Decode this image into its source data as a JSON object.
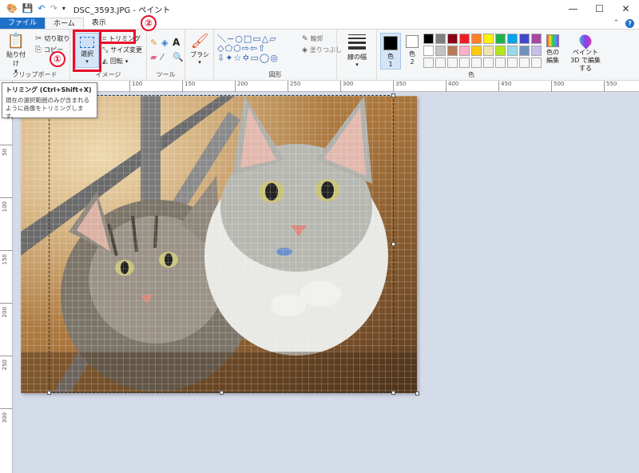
{
  "window": {
    "title": "DSC_3593.JPG - ペイント",
    "controls": {
      "minimize": "—",
      "maximize": "☐",
      "close": "✕"
    }
  },
  "tabs": {
    "file": "ファイル",
    "home": "ホーム",
    "view": "表示"
  },
  "ribbon": {
    "clipboard": {
      "paste": "貼り付け",
      "cut": "切り取り",
      "copy": "コピー",
      "label": "クリップボード"
    },
    "image": {
      "select": "選択",
      "crop": "トリミング",
      "resize": "サイズ変更",
      "rotate": "回転",
      "label": "イメージ"
    },
    "tools": {
      "label": "ツール"
    },
    "brushes": {
      "label": "ブラシ"
    },
    "shapes": {
      "outline": "輪郭",
      "fill": "塗りつぶし",
      "label": "図形"
    },
    "size": {
      "label": "線の幅"
    },
    "colors": {
      "color1": "色",
      "color1_num": "1",
      "color2": "色",
      "color2_num": "2",
      "edit": "色の編集",
      "paint3d": "ペイント 3D で編集する",
      "label": "色",
      "palette_row1": [
        "#000000",
        "#7f7f7f",
        "#880015",
        "#ed1c24",
        "#ff7f27",
        "#fff200",
        "#22b14c",
        "#00a2e8",
        "#3f48cc",
        "#a349a4"
      ],
      "palette_row2": [
        "#ffffff",
        "#c3c3c3",
        "#b97a57",
        "#ffaec9",
        "#ffc90e",
        "#efe4b0",
        "#b5e61d",
        "#99d9ea",
        "#7092be",
        "#c8bfe7"
      ]
    }
  },
  "annotations": {
    "marker1": "①",
    "marker2": "②"
  },
  "tooltip": {
    "title": "トリミング (Ctrl+Shift+X)",
    "body": "現在の選択範囲のみが含まれるように画像をトリミングします。"
  },
  "ruler": {
    "h": [
      "100",
      "150",
      "200",
      "250",
      "300",
      "350",
      "400",
      "450",
      "500",
      "550"
    ],
    "v": [
      "50",
      "100",
      "150",
      "200",
      "250",
      "300"
    ]
  }
}
